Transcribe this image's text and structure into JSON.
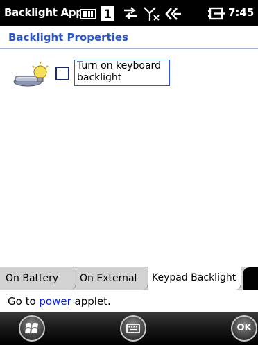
{
  "titlebar": {
    "app_title": "Backlight App",
    "badge_number": "1",
    "clock": "7:45",
    "icons": [
      "battery-icon",
      "number-badge",
      "data-connection-icon",
      "no-signal-icon",
      "volume-icon",
      "power-plug-icon"
    ]
  },
  "page": {
    "title": "Backlight Properties"
  },
  "settings": {
    "keyboard_backlight_label": "Turn on keyboard backlight",
    "keyboard_backlight_checked": false
  },
  "tabs": [
    {
      "label": "On Battery",
      "selected": false
    },
    {
      "label": "On External",
      "selected": false
    },
    {
      "label": "Keypad Backlight",
      "selected": true
    }
  ],
  "footer_text": {
    "prefix": "Go to ",
    "link": "power",
    "suffix": " applet."
  },
  "softkeys": {
    "ok_label": "OK",
    "icons": [
      "windows-start-icon",
      "keyboard-icon",
      "ok-button"
    ]
  },
  "colors": {
    "title_blue": "#2b56c6",
    "link_blue": "#0b24d6",
    "titlebar_bg": "#000000"
  }
}
